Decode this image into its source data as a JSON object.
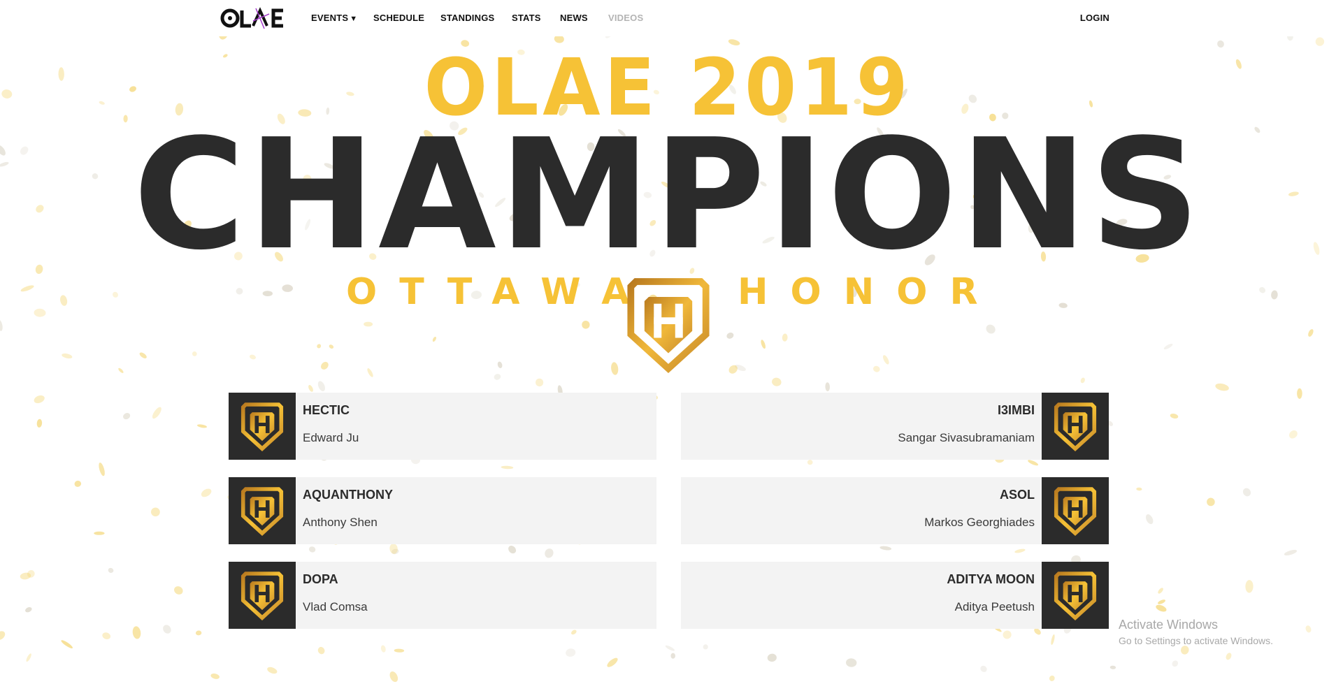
{
  "nav": {
    "logo_text": "OLAE",
    "events_label": "EVENTS",
    "schedule_label": "SCHEDULE",
    "standings_label": "STANDINGS",
    "stats_label": "STATS",
    "news_label": "NEWS",
    "videos_label": "VIDEOS",
    "login_label": "LOGIN"
  },
  "hero": {
    "year_title": "OLAE 2019",
    "main_title": "CHAMPIONS",
    "team_word_1": "OTTAWA",
    "team_word_2": "HONOR"
  },
  "roster": {
    "left": [
      {
        "gamertag": "HECTIC",
        "name": "Edward Ju"
      },
      {
        "gamertag": "AQUANTHONY",
        "name": "Anthony Shen"
      },
      {
        "gamertag": "DOPA",
        "name": "Vlad Comsa"
      }
    ],
    "right": [
      {
        "gamertag": "I3IMBI",
        "name": "Sangar Sivasubramaniam"
      },
      {
        "gamertag": "ASOL",
        "name": "Markos Georghiades"
      },
      {
        "gamertag": "ADITYA MOON",
        "name": "Aditya Peetush"
      }
    ]
  },
  "watermark": {
    "title": "Activate Windows",
    "subtitle": "Go to Settings to activate Windows."
  },
  "colors": {
    "gold": "#f6c236",
    "dark": "#2b2b2b",
    "card_bg": "#f3f3f3",
    "logo_accent": "#a23bc9"
  },
  "icons": {
    "crest": "ottawa-honor-crest-icon",
    "events_caret": "caret-down-icon"
  }
}
